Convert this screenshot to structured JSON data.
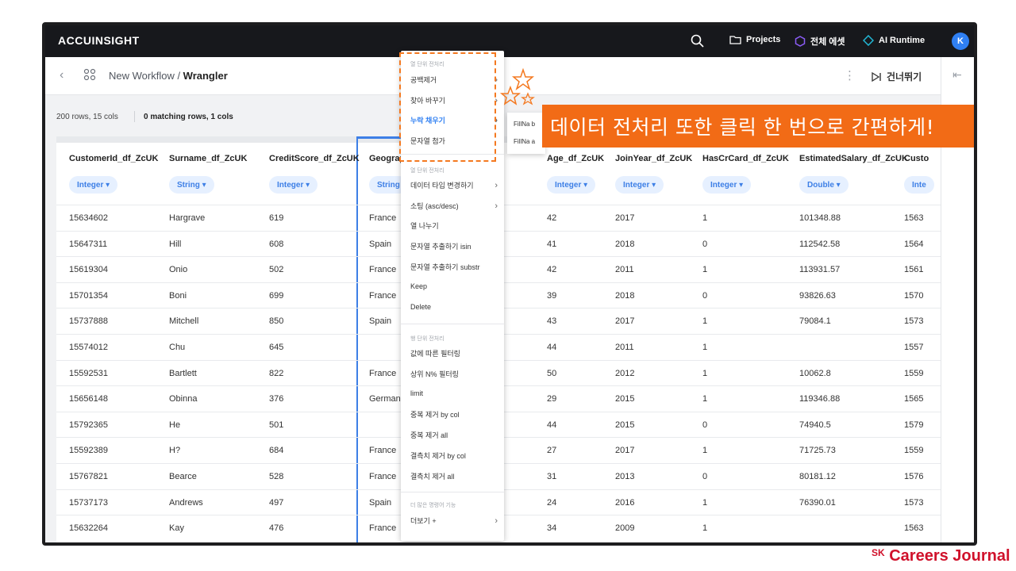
{
  "topbar": {
    "logo": "ACCUINSIGHT",
    "projects": "Projects",
    "assets": "전체 에셋",
    "runtime": "AI Runtime",
    "avatar": "K"
  },
  "workflow": {
    "crumb_parent": "New Workflow / ",
    "crumb_current": "Wrangler",
    "skip_label": "건너뛰기"
  },
  "info": {
    "rows_cols": "200 rows, 15 cols",
    "matching": "0 matching rows, 1 cols"
  },
  "table": {
    "columns": [
      {
        "name": "CustomerId_df_ZcUK",
        "type": "Integer ▾"
      },
      {
        "name": "Surname_df_ZcUK",
        "type": "String ▾"
      },
      {
        "name": "CreditScore_df_ZcUK",
        "type": "Integer ▾"
      },
      {
        "name": "Geograp",
        "type": "String"
      },
      {
        "name": "Age_df_ZcUK",
        "type": "Integer ▾"
      },
      {
        "name": "JoinYear_df_ZcUK",
        "type": "Integer ▾"
      },
      {
        "name": "HasCrCard_df_ZcUK",
        "type": "Integer ▾"
      },
      {
        "name": "EstimatedSalary_df_ZcUK",
        "type": "Double ▾"
      },
      {
        "name": "Custo",
        "type": "Inte"
      }
    ],
    "rows": [
      [
        "15634602",
        "Hargrave",
        "619",
        "France",
        "42",
        "2017",
        "1",
        "101348.88",
        "1563"
      ],
      [
        "15647311",
        "Hill",
        "608",
        "Spain",
        "41",
        "2018",
        "0",
        "112542.58",
        "1564"
      ],
      [
        "15619304",
        "Onio",
        "502",
        "France",
        "42",
        "2011",
        "1",
        "113931.57",
        "1561"
      ],
      [
        "15701354",
        "Boni",
        "699",
        "France",
        "39",
        "2018",
        "0",
        "93826.63",
        "1570"
      ],
      [
        "15737888",
        "Mitchell",
        "850",
        "Spain",
        "43",
        "2017",
        "1",
        "79084.1",
        "1573"
      ],
      [
        "15574012",
        "Chu",
        "645",
        "",
        "44",
        "2011",
        "1",
        "",
        "1557"
      ],
      [
        "15592531",
        "Bartlett",
        "822",
        "France",
        "50",
        "2012",
        "1",
        "10062.8",
        "1559"
      ],
      [
        "15656148",
        "Obinna",
        "376",
        "German",
        "29",
        "2015",
        "1",
        "119346.88",
        "1565"
      ],
      [
        "15792365",
        "He",
        "501",
        "",
        "44",
        "2015",
        "0",
        "74940.5",
        "1579"
      ],
      [
        "15592389",
        "H?",
        "684",
        "France",
        "27",
        "2017",
        "1",
        "71725.73",
        "1559"
      ],
      [
        "15767821",
        "Bearce",
        "528",
        "France",
        "31",
        "2013",
        "0",
        "80181.12",
        "1576"
      ],
      [
        "15737173",
        "Andrews",
        "497",
        "Spain",
        "24",
        "2016",
        "1",
        "76390.01",
        "1573"
      ],
      [
        "15632264",
        "Kay",
        "476",
        "France",
        "34",
        "2009",
        "1",
        "",
        "1563"
      ]
    ]
  },
  "menu": {
    "sec1": "열 단위 전처리",
    "sec2": "열 단위 전처리",
    "sec3": "행 단위 전처리",
    "sec4": "더 많은 명령어 기능",
    "items1": [
      "공백제거",
      "찾아 바꾸기",
      "누락 채우기",
      "문자열 첨가"
    ],
    "items2": [
      "데이터 타입 변경하기",
      "소팅 (asc/desc)",
      "열 나누기",
      "문자열 추출하기 isin",
      "문자열 추출하기 substr",
      "Keep",
      "Delete"
    ],
    "items3": [
      "값에 따른 필터링",
      "상위 N% 필터링",
      "limit",
      "중복 제거 by col",
      "중복 제거 all",
      "결측치 제거 by col",
      "결측치 제거 all"
    ],
    "more": "더보기 +",
    "sub": [
      "FillNa b",
      "FillNa a"
    ]
  },
  "banner": "데이터 전처리 또한 클릭 한 번으로 간편하게!",
  "brand": {
    "sk": "SK",
    "name": "Careers Journal"
  }
}
